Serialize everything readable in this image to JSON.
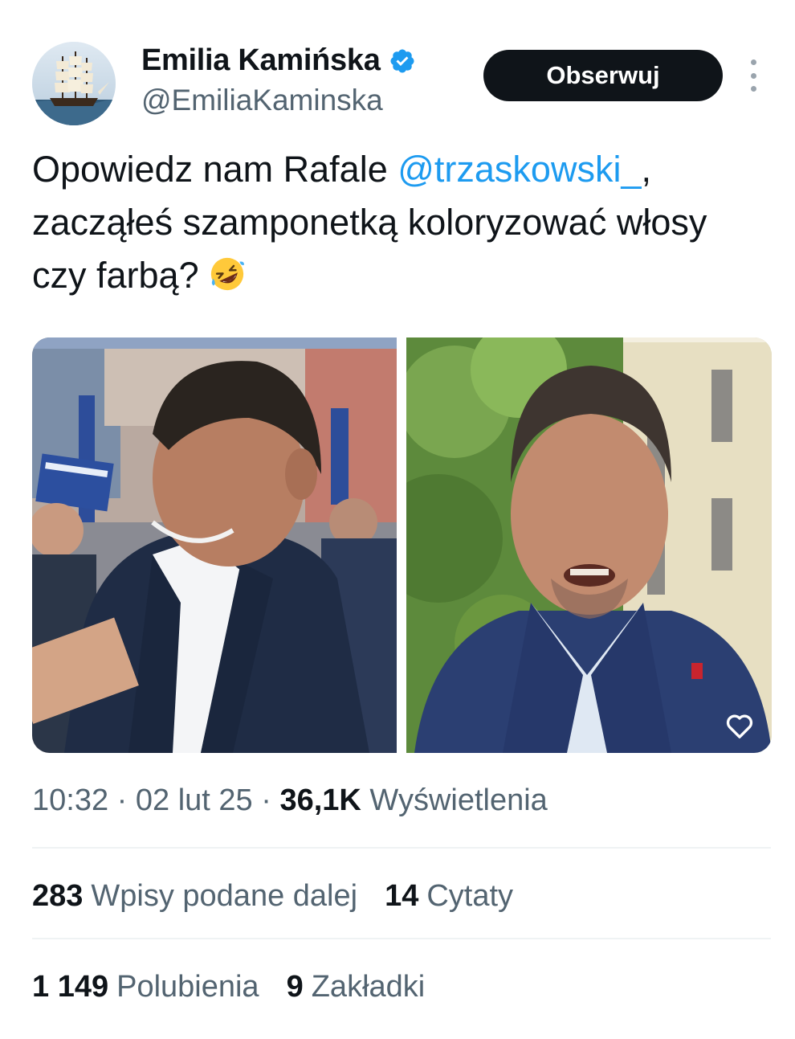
{
  "author": {
    "name": "Emilia Kamińska",
    "handle": "@EmiliaKaminska",
    "verified": true
  },
  "follow_button_label": "Obserwuj",
  "tweet": {
    "text_before": "Opowiedz nam Rafale ",
    "mention": "@trzaskowski_",
    "text_after": ", zacząłeś szamponetką koloryzować włosy czy farbą?",
    "emoji": "rolling-on-floor-laughing"
  },
  "media": {
    "count": 2
  },
  "meta": {
    "time": "10:32",
    "date": "02 lut 25",
    "views_count": "36,1K",
    "views_label": "Wyświetlenia",
    "separator": "·"
  },
  "stats": {
    "reposts_count": "283",
    "reposts_label": "Wpisy podane dalej",
    "quotes_count": "14",
    "quotes_label": "Cytaty",
    "likes_count": "1 149",
    "likes_label": "Polubienia",
    "bookmarks_count": "9",
    "bookmarks_label": "Zakładki"
  },
  "colors": {
    "text": "#0f1419",
    "secondary": "#536471",
    "link": "#1d9bf0",
    "verified": "#1d9bf0",
    "divider": "#eff3f4"
  }
}
